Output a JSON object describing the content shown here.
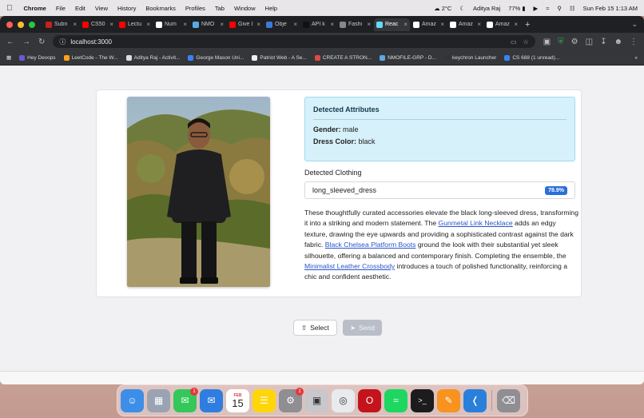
{
  "menubar": {
    "app_name": "Chrome",
    "menus": [
      "File",
      "Edit",
      "View",
      "History",
      "Bookmarks",
      "Profiles",
      "Tab",
      "Window",
      "Help"
    ],
    "weather": "2°C",
    "user": "Aditya Raj",
    "battery": "77%",
    "datetime": "Sun Feb 15  1:13 AM"
  },
  "tabs": [
    {
      "label": "Subn",
      "color": "#c5221f"
    },
    {
      "label": "CS50",
      "color": "#ff0000"
    },
    {
      "label": "Lectu",
      "color": "#ff0000"
    },
    {
      "label": "Num",
      "color": "#ffffff"
    },
    {
      "label": "NMO",
      "color": "#5aa9e6"
    },
    {
      "label": "Give I",
      "color": "#ff0000"
    },
    {
      "label": "Obje",
      "color": "#3b7bd8"
    },
    {
      "label": "API k",
      "color": "#111111"
    },
    {
      "label": "Fashi",
      "color": "#888888"
    },
    {
      "label": "Reac",
      "color": "#61dafb",
      "active": true
    },
    {
      "label": "Amaz",
      "color": "#ffffff"
    },
    {
      "label": "Amaz",
      "color": "#ffffff"
    },
    {
      "label": "Amaz",
      "color": "#ffffff"
    }
  ],
  "address": {
    "url": "localhost:3000"
  },
  "bookmarks": [
    {
      "label": "Hey Devops",
      "color": "#6a5acd"
    },
    {
      "label": "LeetCode - The W...",
      "color": "#ffa116"
    },
    {
      "label": "Aditya Raj - Activit...",
      "color": "#dddddd"
    },
    {
      "label": "George Mason Uni...",
      "color": "#3b82f6"
    },
    {
      "label": "Patriot Web - A Se...",
      "color": "#eeeeee"
    },
    {
      "label": "CREATE A STRON...",
      "color": "#e04848"
    },
    {
      "label": "NMOFILE-GRP - D...",
      "color": "#5aa9e6"
    },
    {
      "label": "keychron Launcher",
      "color": "#333333"
    },
    {
      "label": "CS 688 (1 unread)...",
      "color": "#3b82f6"
    }
  ],
  "attributes": {
    "title": "Detected Attributes",
    "gender_label": "Gender:",
    "gender_value": "male",
    "dress_label": "Dress Color:",
    "dress_value": "black"
  },
  "clothing": {
    "title": "Detected Clothing",
    "item": "long_sleeved_dress",
    "confidence": "78.9%"
  },
  "description": {
    "p1": "These thoughtfully curated accessories elevate the black long-sleeved dress, transforming it into a striking and modern statement. The ",
    "link1": "Gunmetal Link Necklace",
    "p2": " adds an edgy texture, drawing the eye upwards and providing a sophisticated contrast against the dark fabric. ",
    "link2": "Black Chelsea Platform Boots",
    "p3": " ground the look with their substantial yet sleek silhouette, offering a balanced and contemporary finish. Completing the ensemble, the ",
    "link3": "Minimalist Leather Crossbody",
    "p4": " introduces a touch of polished functionality, reinforcing a chic and confident aesthetic."
  },
  "actions": {
    "select_label": "Select",
    "send_label": "Send"
  },
  "dock": [
    {
      "name": "finder-icon",
      "color": "#3d8ee8"
    },
    {
      "name": "launchpad-icon",
      "color": "#9aa3b2"
    },
    {
      "name": "messages-icon",
      "color": "#34c759",
      "badge": "1"
    },
    {
      "name": "mail-icon",
      "color": "#2f7de1"
    },
    {
      "name": "calendar-icon",
      "color": "#ffffff",
      "month": "FEB",
      "day": "15"
    },
    {
      "name": "notes-icon",
      "color": "#ffd60a"
    },
    {
      "name": "settings-icon",
      "color": "#8e8e93",
      "badge": "1"
    },
    {
      "name": "preview-icon",
      "color": "#c7c7cc"
    },
    {
      "name": "chrome-icon",
      "color": "#e8eaed"
    },
    {
      "name": "opera-icon",
      "color": "#c3141c"
    },
    {
      "name": "spotify-icon",
      "color": "#1ed760"
    },
    {
      "name": "terminal-icon",
      "color": "#1c1c1e"
    },
    {
      "name": "pages-icon",
      "color": "#f7931e"
    },
    {
      "name": "vscode-icon",
      "color": "#2a7fdb"
    },
    {
      "name": "trash-icon",
      "color": "#8e8e93"
    }
  ]
}
